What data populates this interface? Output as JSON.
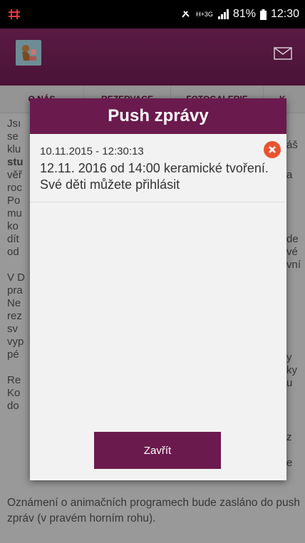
{
  "status_bar": {
    "battery_percent": "81%",
    "network": "H+3G",
    "time": "12:30"
  },
  "tabs": [
    {
      "label": "O NÁS"
    },
    {
      "label": "REZERVACE"
    },
    {
      "label": "FOTOGALERIE"
    },
    {
      "label": "K"
    }
  ],
  "background": {
    "line_fragments_left": [
      "Jsı",
      "se",
      "klu",
      "stu",
      "věř",
      "roc",
      "Po",
      "mu",
      "ko",
      "dít",
      "od",
      "V D",
      "pra",
      "Ne",
      "rez",
      "sv",
      "vyp",
      "pé",
      "Re",
      "Ko",
      "do"
    ],
    "line_fragments_right": [
      "áš",
      "a",
      "de",
      "vé",
      "vní",
      "y",
      "ky",
      "u",
      "z",
      "e"
    ],
    "bottom_text": "Oznámení o animačních programech bude zasláno do push zpráv (v pravém horním rohu)."
  },
  "dialog": {
    "title": "Push zprávy",
    "messages": [
      {
        "date": "10.11.2015 - 12:30:13",
        "text": "12.11. 2016 od 14:00 keramické tvoření. Své děti můžete přihlásit"
      }
    ],
    "close_label": "Zavřít"
  },
  "colors": {
    "primary": "#6b1a4d",
    "delete": "#e8542f"
  }
}
